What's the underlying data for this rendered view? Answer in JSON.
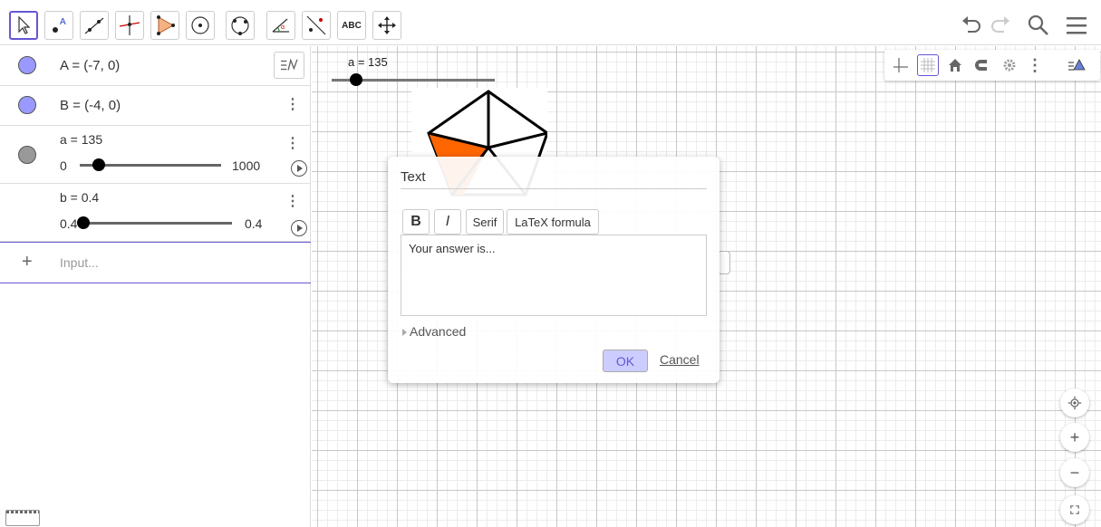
{
  "toolbar": {
    "text_tool_label": "ABC",
    "tools": [
      {
        "name": "move-tool",
        "icon": "pointer-arrow-icon"
      },
      {
        "name": "point-tool",
        "icon": "point-icon"
      },
      {
        "name": "line-tool",
        "icon": "line-icon"
      },
      {
        "name": "perpendicular-tool",
        "icon": "perpendicular-icon"
      },
      {
        "name": "polygon-tool",
        "icon": "polygon-icon"
      },
      {
        "name": "circle-tool",
        "icon": "circle-icon"
      },
      {
        "name": "circle-through-points-tool",
        "icon": "circle-points-icon"
      },
      {
        "name": "angle-tool",
        "icon": "angle-icon"
      },
      {
        "name": "reflect-tool",
        "icon": "reflect-icon"
      },
      {
        "name": "text-tool",
        "icon": "text-icon"
      },
      {
        "name": "move-graphics-tool",
        "icon": "move-arrows-icon"
      }
    ]
  },
  "algebra": {
    "rows": [
      {
        "text": "A = (-7, 0)"
      },
      {
        "text": "B = (-4, 0)"
      },
      {
        "text": "a = 135",
        "slider_min": "0",
        "slider_max": "1000",
        "slider_fraction": 0.135
      },
      {
        "text": "b = 0.4",
        "slider_min": "0.4",
        "slider_max": "0.4",
        "slider_fraction": 0
      }
    ],
    "input_placeholder": "Input..."
  },
  "graphics": {
    "slider_label": "a = 135"
  },
  "dialog": {
    "title": "Text",
    "bold_label": "B",
    "italic_label": "I",
    "serif_label": "Serif",
    "latex_label": "LaTeX formula",
    "text_value": "Your answer is...",
    "advanced_label": "Advanced",
    "ok_label": "OK",
    "cancel_label": "Cancel"
  },
  "colors": {
    "accent": "#6557d2",
    "point_fill": "#9999ff",
    "slider_marble": "#999999",
    "orange_fill": "#ff6600"
  }
}
